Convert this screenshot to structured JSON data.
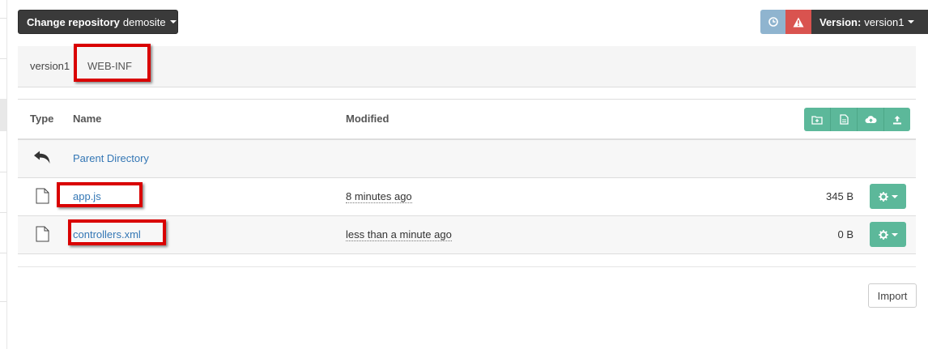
{
  "repository": {
    "label": "Change repository",
    "value": "demosite"
  },
  "version": {
    "label": "Version:",
    "value": "version1",
    "icons": [
      "clock-icon",
      "warning-icon"
    ]
  },
  "breadcrumb": [
    "version1",
    "WEB-INF"
  ],
  "table": {
    "headers": {
      "type": "Type",
      "name": "Name",
      "modified": "Modified"
    },
    "toolbar_icons": [
      "new-folder-icon",
      "new-file-icon",
      "cloud-upload-icon",
      "upload-icon"
    ],
    "parent": {
      "label": "Parent Directory",
      "icon": "back-arrow-icon"
    },
    "rows": [
      {
        "name": "app.js",
        "modified": "8 minutes ago",
        "size": "345 B",
        "icon": "file-icon"
      },
      {
        "name": "controllers.xml",
        "modified": "less than a minute ago",
        "size": "0 B",
        "icon": "file-icon"
      }
    ]
  },
  "import_label": "Import",
  "colors": {
    "dark_button": "#3a3a3a",
    "success": "#5cb89a",
    "danger": "#d9534f",
    "info": "#8fb4cf",
    "link": "#3477b5",
    "highlight": "#d90000"
  }
}
